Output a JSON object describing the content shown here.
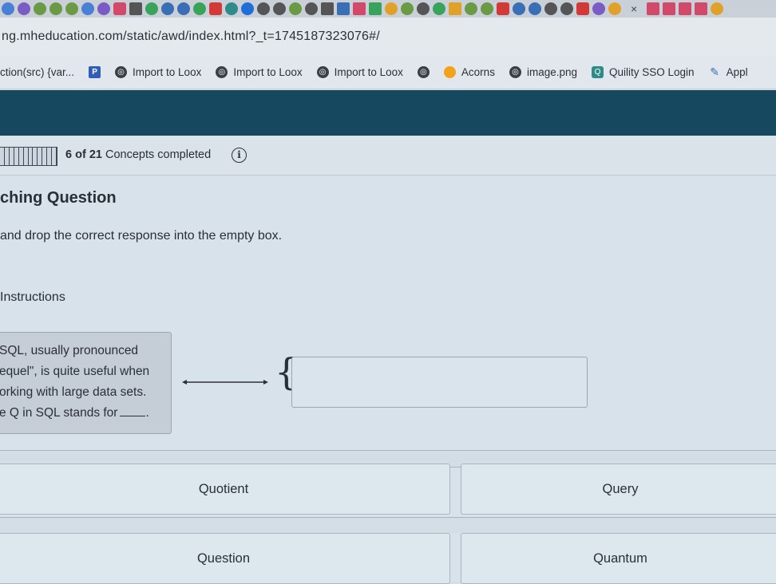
{
  "browser": {
    "url": "ng.mheducation.com/static/awd/index.html?_t=1745187323076#/",
    "tab_close_glyph": "×",
    "bookmarks": [
      {
        "label": "ction(src) {var...",
        "icon": "none"
      },
      {
        "label": "",
        "icon": "p-square-icon"
      },
      {
        "label": "Import to Loox",
        "icon": "globe-icon"
      },
      {
        "label": "Import to Loox",
        "icon": "globe-icon"
      },
      {
        "label": "Import to Loox",
        "icon": "globe-icon"
      },
      {
        "label": "",
        "icon": "globe-icon"
      },
      {
        "label": "Acorns",
        "icon": "acorns-icon"
      },
      {
        "label": "image.png",
        "icon": "globe-icon"
      },
      {
        "label": "Quility SSO Login",
        "icon": "quility-icon"
      },
      {
        "label": "Appl",
        "icon": "quill-icon"
      }
    ]
  },
  "progress": {
    "completed": "6",
    "total_text": "of 21",
    "label": "Concepts completed",
    "fraction": 0.2857
  },
  "question": {
    "title": "ching Question",
    "instruction": "and drop the correct response into the empty box.",
    "instructions_link": "Instructions",
    "prompt_lines": [
      "SQL, usually pronounced",
      "equel\", is quite useful when",
      "orking with large data sets.",
      "e Q in SQL stands for"
    ],
    "prompt_end": "."
  },
  "options": [
    "Quotient",
    "Query",
    "Question",
    "Quantum"
  ],
  "colors": {
    "header": "#16485f",
    "background": "#d7e2ea"
  }
}
